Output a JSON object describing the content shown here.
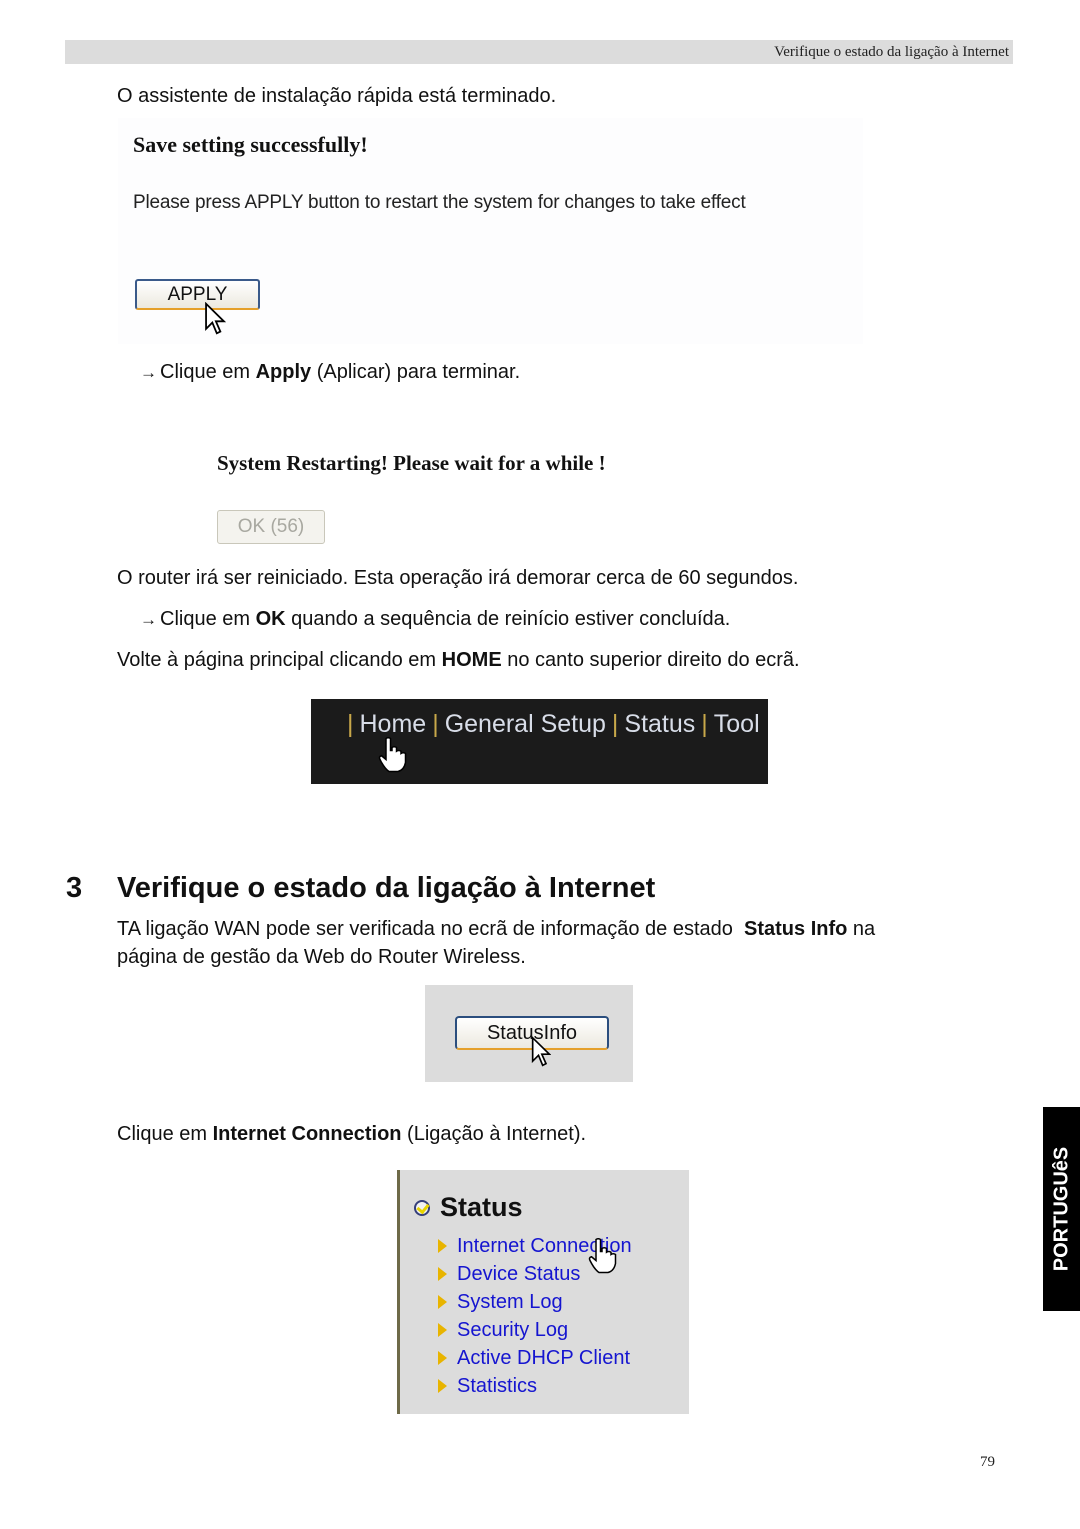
{
  "header": {
    "running_title": "Verifique o estado da ligação à Internet"
  },
  "intro_text": "O assistente de instalação rápida está terminado.",
  "save_screenshot": {
    "title": "Save setting successfully!",
    "message": "Please press APPLY button to restart the system for changes to take effect",
    "apply_button": "APPLY"
  },
  "step_apply": {
    "arrow": "→",
    "prefix": "Clique em ",
    "bold": "Apply",
    "suffix": " (Aplicar) para terminar."
  },
  "restart_screenshot": {
    "title": "System Restarting! Please wait for a while !",
    "ok_button": "OK (56)"
  },
  "restart_text": "O router irá ser reiniciado. Esta operação irá demorar cerca de 60 segundos.",
  "step_ok": {
    "arrow": "→",
    "prefix": "Clique em ",
    "bold": "OK",
    "suffix": " quando a sequência de reinício estiver concluída."
  },
  "home_text": {
    "prefix": "Volte à página principal clicando em ",
    "bold": "HOME",
    "suffix": " no canto superior direito do ecrã."
  },
  "nav_screenshot": {
    "separator": "|",
    "items": [
      {
        "label": "Home"
      },
      {
        "label": "General Setup"
      },
      {
        "label": "Status"
      },
      {
        "label": "Tool"
      }
    ]
  },
  "section": {
    "number": "3",
    "title": "Verifique o estado da ligação à Internet",
    "body_prefix": "TA ligação WAN pode ser verificada no ecrã de informação de estado  ",
    "body_bold": "Status Info",
    "body_suffix": " na",
    "body_line2": "página de gestão da Web do Router Wireless."
  },
  "statusinfo_screenshot": {
    "button": "StatusInfo"
  },
  "internet_conn_text": {
    "prefix": "Clique em ",
    "bold": "Internet Connection",
    "suffix": " (Ligação à Internet)."
  },
  "status_menu_screenshot": {
    "title": "Status",
    "items": [
      {
        "label": "Internet Connection"
      },
      {
        "label": "Device Status"
      },
      {
        "label": "System Log"
      },
      {
        "label": "Security Log"
      },
      {
        "label": "Active DHCP Client"
      },
      {
        "label": "Statistics"
      }
    ]
  },
  "side_tab": {
    "label": "PORTUGUêS"
  },
  "page_number": "79"
}
